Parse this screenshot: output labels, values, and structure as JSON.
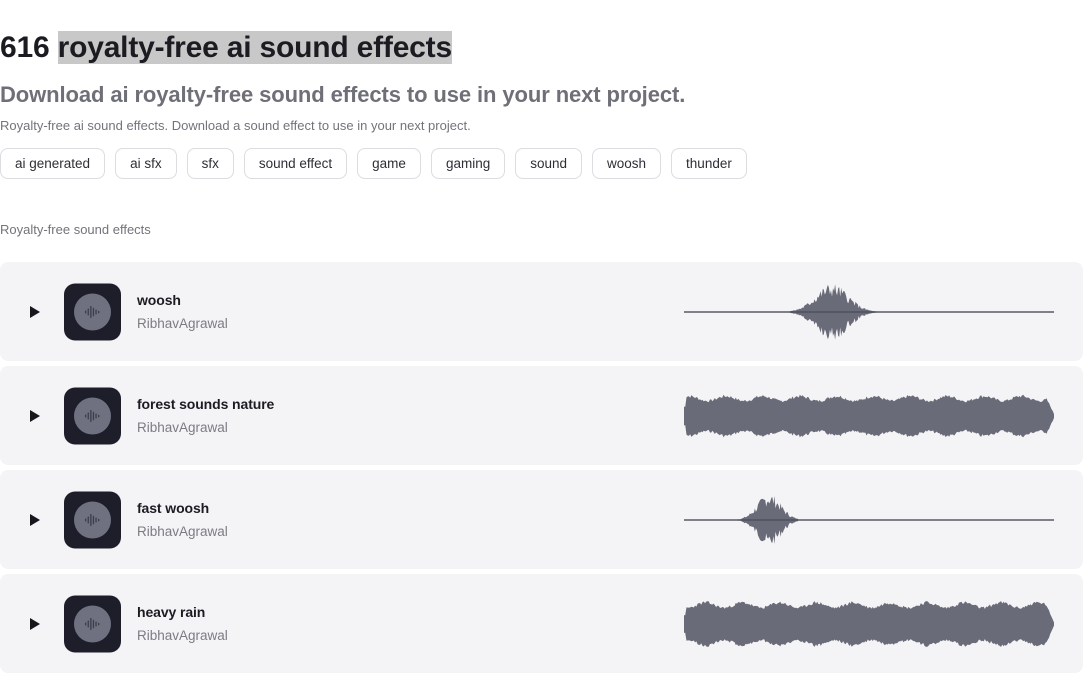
{
  "header": {
    "count": "616",
    "title_selected": "royalty-free ai sound effects",
    "subtitle": "Download ai royalty-free sound effects to use in your next project.",
    "description": "Royalty-free ai sound effects. Download a sound effect to use in your next project.",
    "selection_highlight_color": "#c8c8c8"
  },
  "tags": [
    {
      "label": "ai generated"
    },
    {
      "label": "ai sfx"
    },
    {
      "label": "sfx"
    },
    {
      "label": "sound effect"
    },
    {
      "label": "game"
    },
    {
      "label": "gaming"
    },
    {
      "label": "sound"
    },
    {
      "label": "woosh"
    },
    {
      "label": "thunder"
    }
  ],
  "section": {
    "label": "Royalty-free sound effects"
  },
  "sounds": [
    {
      "name": "woosh",
      "author": "RibhavAgrawal",
      "play_icon": "play-icon",
      "thumb_icon": "audio-waveform-icon",
      "waveform_type": "burst",
      "burst_center_pct": 40,
      "burst_width_pct": 11,
      "burst_peak": 0.95
    },
    {
      "name": "forest sounds nature",
      "author": "RibhavAgrawal",
      "play_icon": "play-icon",
      "thumb_icon": "audio-waveform-icon",
      "waveform_type": "dense",
      "dense_level": 0.78,
      "dense_seed": 7
    },
    {
      "name": "fast woosh",
      "author": "RibhavAgrawal",
      "play_icon": "play-icon",
      "thumb_icon": "audio-waveform-icon",
      "waveform_type": "burst",
      "burst_center_pct": 23,
      "burst_width_pct": 8,
      "burst_peak": 0.88
    },
    {
      "name": "heavy rain",
      "author": "RibhavAgrawal",
      "play_icon": "play-icon",
      "thumb_icon": "audio-waveform-icon",
      "waveform_type": "dense",
      "dense_level": 0.84,
      "dense_seed": 23
    }
  ],
  "colors": {
    "row_background": "#f4f4f6",
    "waveform": "#6a6b78",
    "thumb_background": "#1d1e2a",
    "thumb_disc": "#6f7180",
    "title_text": "#1b1b22",
    "muted_text": "#73737c"
  }
}
